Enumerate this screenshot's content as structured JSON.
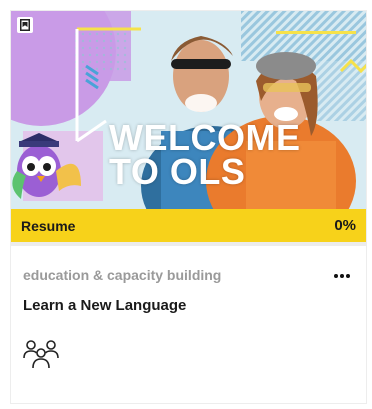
{
  "card": {
    "banner": {
      "headline_line1": "WELCOME",
      "headline_line2": "TO OLS"
    },
    "progress": {
      "resume_label": "Resume",
      "percent_label": "0%",
      "value": 0
    },
    "category": "education & capacity building",
    "title": "Learn a New Language",
    "icons": {
      "bookmark": "bookmark-icon",
      "more": "more-options-icon",
      "audience": "group-icon"
    },
    "colors": {
      "progress_bar": "#f7d21a",
      "category_text": "#9a9a9a",
      "title_text": "#1a1a1a"
    }
  }
}
